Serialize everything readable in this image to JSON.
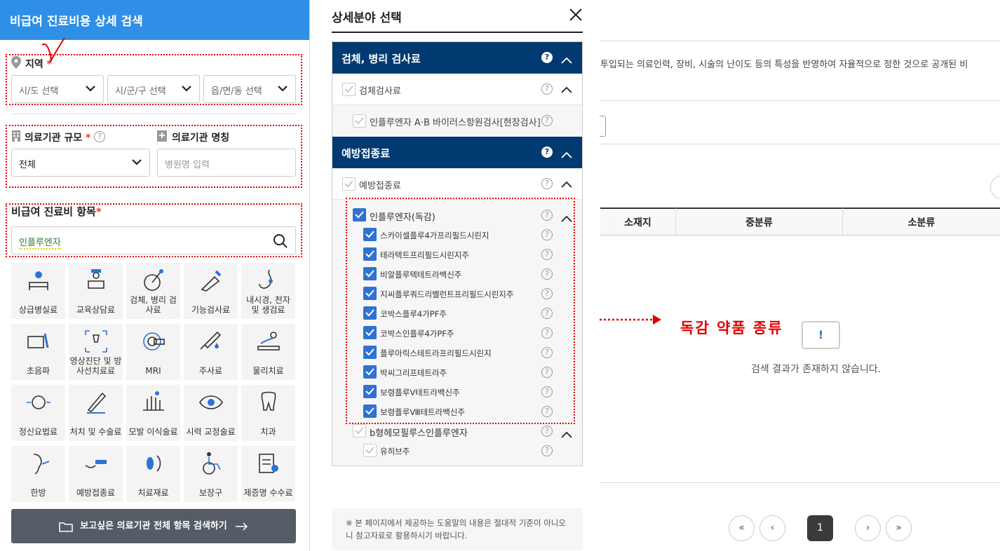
{
  "left_panel": {
    "title": "비급여 진료비용 상세 검색",
    "region": {
      "label": "지역",
      "required_mark": "*",
      "selects": [
        "시/도 선택",
        "시/군/구 선택",
        "읍/면/동 선택"
      ]
    },
    "scale": {
      "label": "의료기관 규모",
      "required_mark": "*",
      "value": "전체"
    },
    "name": {
      "label": "의료기관 명칭",
      "placeholder": "병원명 입력"
    },
    "item": {
      "label": "비급여 진료비 항목",
      "required_mark": "*",
      "value": "인플루엔자"
    },
    "categories": [
      {
        "label": "상급병실료",
        "icon": "bed-icon"
      },
      {
        "label": "교육상담료",
        "icon": "counsel-icon"
      },
      {
        "label": "검체, 병리 검사료",
        "icon": "specimen-icon"
      },
      {
        "label": "기능검사료",
        "icon": "function-test-icon"
      },
      {
        "label": "내시경, 천자 및 생검료",
        "icon": "endoscope-icon"
      },
      {
        "label": "초음파",
        "icon": "ultrasound-icon"
      },
      {
        "label": "영상진단 및 방사선치료료",
        "icon": "radiology-icon"
      },
      {
        "label": "MRI",
        "icon": "mri-icon"
      },
      {
        "label": "주사료",
        "icon": "syringe-icon"
      },
      {
        "label": "물리치료",
        "icon": "physio-icon"
      },
      {
        "label": "정신요법료",
        "icon": "brain-icon"
      },
      {
        "label": "처치 및 수술료",
        "icon": "surgery-icon"
      },
      {
        "label": "모발 이식술료",
        "icon": "hair-icon"
      },
      {
        "label": "시력 교정술료",
        "icon": "eye-icon"
      },
      {
        "label": "치과",
        "icon": "tooth-icon"
      },
      {
        "label": "한방",
        "icon": "acupuncture-icon"
      },
      {
        "label": "예방접종료",
        "icon": "vaccine-icon"
      },
      {
        "label": "치료재료",
        "icon": "material-icon"
      },
      {
        "label": "보장구",
        "icon": "wheelchair-icon"
      },
      {
        "label": "제증명 수수료",
        "icon": "certificate-icon"
      }
    ],
    "search_all_button": "보고싶은 의료기관 전체 항목 검색하기"
  },
  "modal": {
    "title": "상세분야 선택",
    "groups": [
      {
        "title": "검체, 병리 검사료",
        "sub": "검체검사료",
        "items": [
          "인플루엔자 A·B 바이러스항원검사[현장검사]"
        ]
      },
      {
        "title": "예방접종료",
        "sub": "예방접종료",
        "subgroups": [
          {
            "title": "인플루엔자(독감)",
            "checked": true,
            "items": [
              "스카이셀플루4가프리필드시린지",
              "테라텍트프리필드시린지주",
              "비알플루텍테트라백신주",
              "지씨플루쿼드리밸런트프리필드시린지주",
              "코박스플루4가PF주",
              "코박스인플루4가PF주",
              "플루아릭스테트라프리필드시린지",
              "박씨그리프테트라주",
              "보령플루Ⅴ테트라백신주",
              "보령플루Ⅷ테트라백신주"
            ]
          },
          {
            "title": "b형헤모필루스인플루엔자",
            "checked": false,
            "items": [
              "유히브주"
            ]
          }
        ]
      }
    ],
    "note": "※ 본 페이지에서 제공하는 도움말의 내용은 절대적 기준이 아니오니 참고자료로 활용하시기 바랍니다."
  },
  "annotation": {
    "text": "독감 약품 종류",
    "color": "#e10000"
  },
  "background": {
    "description_fragment": "투입되는 의료인력, 장비, 시술의 난이도 등의 특성을 반영하여 자율적으로 정한 것으로 공개된 비",
    "table_headers": [
      "소재지",
      "중분류",
      "소분류"
    ],
    "empty_message": "검색 결과가 존재하지 않습니다.",
    "empty_icon_text": "!",
    "pagination": {
      "current": "1",
      "first": "«",
      "prev": "‹",
      "next": "›",
      "last": "»"
    }
  },
  "colors": {
    "header_blue": "#2f8fe6",
    "category_navy": "#003a70",
    "check_blue": "#2f72d2",
    "annotation_red": "#e10000"
  }
}
